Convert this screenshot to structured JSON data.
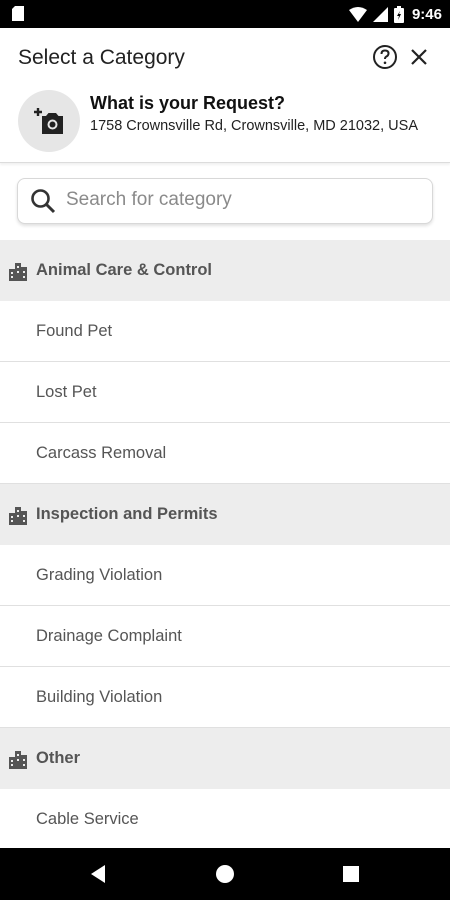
{
  "status_bar": {
    "time": "9:46"
  },
  "app_bar": {
    "title": "Select a Category"
  },
  "request": {
    "question": "What is your Request?",
    "address": "1758 Crownsville Rd, Crownsville, MD 21032, USA"
  },
  "search": {
    "placeholder": "Search for category"
  },
  "groups": [
    {
      "header": "Animal Care & Control",
      "items": [
        "Found Pet",
        "Lost Pet",
        "Carcass Removal"
      ]
    },
    {
      "header": "Inspection and Permits",
      "items": [
        "Grading Violation",
        "Drainage Complaint",
        "Building Violation"
      ]
    },
    {
      "header": "Other",
      "items": [
        "Cable Service"
      ]
    }
  ]
}
